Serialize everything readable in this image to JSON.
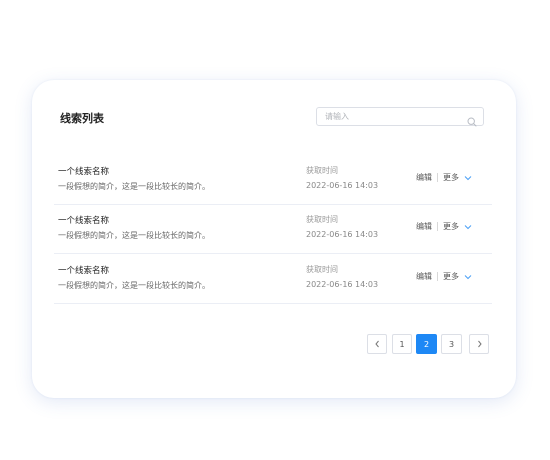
{
  "card": {
    "title": "线索列表",
    "search": {
      "placeholder": "请输入",
      "icon": "search-icon"
    }
  },
  "rows": [
    {
      "name": "一个线索名称",
      "desc": "一段假想的简介，这是一段比较长的简介。",
      "time_label": "获取时间",
      "time": "2022-06-16  14:03",
      "edit": "编辑",
      "more": "更多"
    },
    {
      "name": "一个线索名称",
      "desc": "一段假想的简介，这是一段比较长的简介。",
      "time_label": "获取时间",
      "time": "2022-06-16  14:03",
      "edit": "编辑",
      "more": "更多"
    },
    {
      "name": "一个线索名称",
      "desc": "一段假想的简介，这是一段比较长的简介。",
      "time_label": "获取时间",
      "time": "2022-06-16  14:03",
      "edit": "编辑",
      "more": "更多"
    }
  ],
  "pagination": {
    "pages": [
      "1",
      "2",
      "3"
    ],
    "current_page": "2"
  },
  "colors": {
    "accent": "#1e88f5",
    "chevron": "#4a9ff5"
  }
}
